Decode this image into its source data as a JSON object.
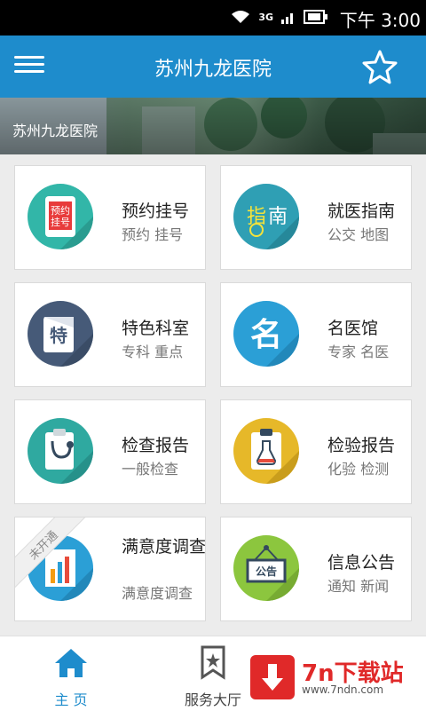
{
  "status": {
    "time": "下午 3:00",
    "network": "3G"
  },
  "header": {
    "title": "苏州九龙医院",
    "menu_icon": "hamburger-menu-icon",
    "fav_icon": "star-icon"
  },
  "banner": {
    "label": "苏州九龙医院"
  },
  "cards": [
    {
      "title": "预约挂号",
      "subtitle": "预约 挂号",
      "icon_text": "预约挂号",
      "icon": "appointment-phone-icon"
    },
    {
      "title": "就医指南",
      "subtitle": "公交 地图",
      "icon_text": "指南",
      "icon": "guide-compass-icon"
    },
    {
      "title": "特色科室",
      "subtitle": "专科 重点",
      "icon_text": "特",
      "icon": "department-badge-icon"
    },
    {
      "title": "名医馆",
      "subtitle": "专家 名医",
      "icon_text": "名",
      "icon": "famous-doctor-icon"
    },
    {
      "title": "检查报告",
      "subtitle": "一般检查",
      "icon_text": "",
      "icon": "stethoscope-clipboard-icon"
    },
    {
      "title": "检验报告",
      "subtitle": "化验 检测",
      "icon_text": "",
      "icon": "lab-flask-clipboard-icon"
    },
    {
      "title": "满意度调查",
      "subtitle": "满意度调查",
      "icon_text": "",
      "icon": "bar-chart-icon",
      "ribbon": "未开通"
    },
    {
      "title": "信息公告",
      "subtitle": "通知 新闻",
      "icon_text": "公告",
      "icon": "notice-board-icon"
    }
  ],
  "tabs": [
    {
      "label": "主 页",
      "icon": "home-icon",
      "active": true
    },
    {
      "label": "服务大厅",
      "icon": "bookmark-star-icon",
      "active": false
    }
  ],
  "watermark": {
    "title": "7n下载站",
    "url": "www.7ndn.com"
  },
  "colors": {
    "primary": "#1e8ccc",
    "active_tab": "#1e8ccc"
  }
}
